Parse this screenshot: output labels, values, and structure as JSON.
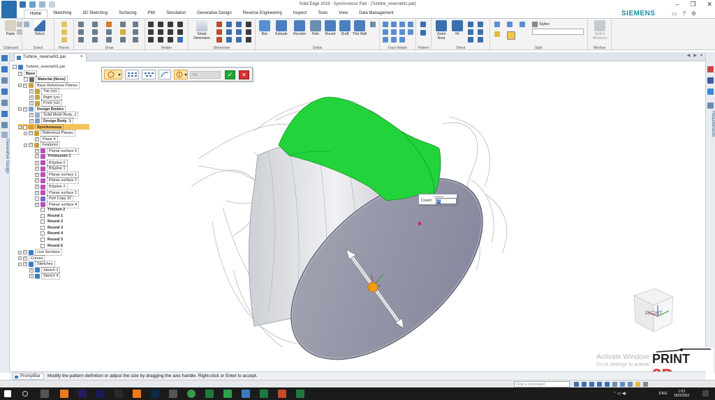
{
  "window": {
    "title": "Solid Edge 2019 - Synchronous Part - [Turbine_reverseN1.par]",
    "controls": [
      "–",
      "❐",
      "✕"
    ]
  },
  "ribbon": {
    "tabs": [
      "Home",
      "Sketching",
      "3D Sketching",
      "Surfacing",
      "PMI",
      "Simulation",
      "Generative Design",
      "Reverse Engineering",
      "Inspect",
      "Tools",
      "View",
      "Data Management"
    ],
    "active_tab": "Home",
    "brand": "SIEMENS",
    "groups": {
      "clipboard": {
        "label": "Clipboard",
        "paste": "Paste"
      },
      "select": {
        "label": "Select",
        "select": "Select"
      },
      "planes": {
        "label": "Planes"
      },
      "draw": {
        "label": "Draw"
      },
      "relate": {
        "label": "Relate"
      },
      "dimension": {
        "label": "Dimension",
        "smart": "Smart Dimension"
      },
      "solids": {
        "label": "Solids",
        "buttons": [
          "Box",
          "Extrude",
          "Revolve",
          "Hole",
          "Round",
          "Draft",
          "Thin Wall"
        ]
      },
      "face_relate": {
        "label": "Face Relate"
      },
      "pattern": {
        "label": "Pattern"
      },
      "orient": {
        "label": "Orient",
        "buttons": [
          "Zoom Area",
          "Fit"
        ]
      },
      "style": {
        "label": "Style",
        "styles": "Styles"
      },
      "window": {
        "label": "Window",
        "switch": "Switch Windows"
      }
    }
  },
  "document_tab": {
    "name": "Turbine_reverseN1.par",
    "close": "×"
  },
  "left_strip": {
    "vertical_label": "Generative Design"
  },
  "right_strip": {
    "vertical_label": "Requirements"
  },
  "tree": [
    {
      "label": "Turbine_reverseN1.par",
      "indent": 0,
      "style": "plain",
      "check": false,
      "exp": false,
      "icon": "#3a7cc4"
    },
    {
      "label": "Base",
      "indent": 1,
      "style": "box",
      "check": true,
      "exp": false,
      "icon": ""
    },
    {
      "label": "Material (None)",
      "indent": 2,
      "style": "box",
      "check": false,
      "exp": false,
      "icon": "#6a6a6a"
    },
    {
      "label": "Base Reference Planes",
      "indent": 1,
      "style": "grey",
      "check": true,
      "exp": true,
      "icon": "#c7a040"
    },
    {
      "label": "Top (xy)",
      "indent": 3,
      "style": "grey",
      "check": true,
      "exp": false,
      "icon": "#c7a040"
    },
    {
      "label": "Right (yz)",
      "indent": 3,
      "style": "grey",
      "check": true,
      "exp": false,
      "icon": "#c7a040"
    },
    {
      "label": "Front (xz)",
      "indent": 3,
      "style": "grey",
      "check": true,
      "exp": false,
      "icon": "#c7a040"
    },
    {
      "label": "Design Bodies",
      "indent": 1,
      "style": "box",
      "check": true,
      "exp": true,
      "icon": "#7aa0c8"
    },
    {
      "label": "Solid Mesh Body_2",
      "indent": 3,
      "style": "grey",
      "check": true,
      "exp": false,
      "icon": "#9ab0c8"
    },
    {
      "label": "Design Body_1",
      "indent": 3,
      "style": "box",
      "check": true,
      "exp": false,
      "icon": "#7aa0c8"
    },
    {
      "label": "Synchronous",
      "indent": 1,
      "style": "sel",
      "check": false,
      "exp": true,
      "icon": "#e29a2a"
    },
    {
      "label": "Reference Planes",
      "indent": 2,
      "style": "grey",
      "check": true,
      "exp": true,
      "icon": "#c7a040"
    },
    {
      "label": "Plane 4",
      "indent": 4,
      "style": "grey",
      "check": true,
      "exp": false,
      "icon": ""
    },
    {
      "label": "Features",
      "indent": 2,
      "style": "grey",
      "check": true,
      "exp": true,
      "icon": "#c7a040"
    },
    {
      "label": "Planar surface 0",
      "indent": 4,
      "style": "grey",
      "check": true,
      "exp": false,
      "icon": "#b94fb9"
    },
    {
      "label": "Protrusion 1",
      "indent": 4,
      "style": "bold",
      "check": true,
      "exp": false,
      "icon": "#b94fb9"
    },
    {
      "label": "BSpline 0",
      "indent": 4,
      "style": "grey",
      "check": true,
      "exp": false,
      "icon": "#b94fb9"
    },
    {
      "label": "BSpline 1",
      "indent": 4,
      "style": "grey",
      "check": true,
      "exp": false,
      "icon": "#b94fb9"
    },
    {
      "label": "Planar surface 1",
      "indent": 4,
      "style": "grey",
      "check": true,
      "exp": false,
      "icon": "#b94fb9"
    },
    {
      "label": "Planar surface 2",
      "indent": 4,
      "style": "grey",
      "check": true,
      "exp": false,
      "icon": "#b94fb9"
    },
    {
      "label": "BSpline 2",
      "indent": 4,
      "style": "grey",
      "check": true,
      "exp": false,
      "icon": "#b94fb9"
    },
    {
      "label": "Planar surface 3",
      "indent": 4,
      "style": "grey",
      "check": true,
      "exp": false,
      "icon": "#b94fb9"
    },
    {
      "label": "Part Copy 32",
      "indent": 4,
      "style": "grey",
      "check": false,
      "exp": false,
      "icon": "#7a6ad0"
    },
    {
      "label": "Planar surface 4",
      "indent": 4,
      "style": "grey",
      "check": true,
      "exp": false,
      "icon": "#b94fb9"
    },
    {
      "label": "Thicken 2",
      "indent": 5,
      "style": "bold",
      "check": false,
      "exp": false,
      "icon": ""
    },
    {
      "label": "Round 1",
      "indent": 5,
      "style": "bold",
      "check": false,
      "exp": false,
      "icon": ""
    },
    {
      "label": "Round 2",
      "indent": 5,
      "style": "bold",
      "check": false,
      "exp": false,
      "icon": ""
    },
    {
      "label": "Round 3",
      "indent": 5,
      "style": "bold",
      "check": false,
      "exp": false,
      "icon": ""
    },
    {
      "label": "Round 4",
      "indent": 5,
      "style": "bold",
      "check": false,
      "exp": false,
      "icon": ""
    },
    {
      "label": "Round 5",
      "indent": 5,
      "style": "bold",
      "check": false,
      "exp": false,
      "icon": ""
    },
    {
      "label": "Round 6",
      "indent": 5,
      "style": "bold",
      "check": false,
      "exp": false,
      "icon": ""
    },
    {
      "label": "Live Sections",
      "indent": 1,
      "style": "grey",
      "check": true,
      "exp": true,
      "icon": "#3a7cc4"
    },
    {
      "label": "Curves",
      "indent": 1,
      "style": "grey",
      "check": true,
      "exp": true,
      "icon": ""
    },
    {
      "label": "Sketches",
      "indent": 1,
      "style": "grey",
      "check": true,
      "exp": true,
      "icon": "#3a7cc4"
    },
    {
      "label": "Sketch 3",
      "indent": 3,
      "style": "grey",
      "check": true,
      "exp": false,
      "icon": "#3a7cc4"
    },
    {
      "label": "Sketch 4",
      "indent": 3,
      "style": "grey",
      "check": true,
      "exp": false,
      "icon": "#3a7cc4"
    }
  ],
  "command_bar": {
    "fit_value": "Fit"
  },
  "count_box": {
    "label": "Count:",
    "value": "3"
  },
  "view_cube": {
    "face": "RIGHT"
  },
  "watermark": {
    "line1": "Activate Windows",
    "line2": "Go to Settings to activate Windows."
  },
  "logo": {
    "line1": "PRINT",
    "line2": "3D"
  },
  "prompt_bar": {
    "tab": "PromptBar",
    "text": "Modify the pattern definition or adjust the size by dragging the axis handle.  Right-click or Enter to accept."
  },
  "status_bar": {
    "find_placeholder": "Find a command"
  },
  "taskbar": {
    "lang": "ENG",
    "time": "1:03",
    "date": "18/3/2562"
  },
  "colors": {
    "accent": "#3a7cc4",
    "selected": "#f7c15a",
    "green_face": "#22d33c",
    "disk": "#8c8c9c"
  }
}
